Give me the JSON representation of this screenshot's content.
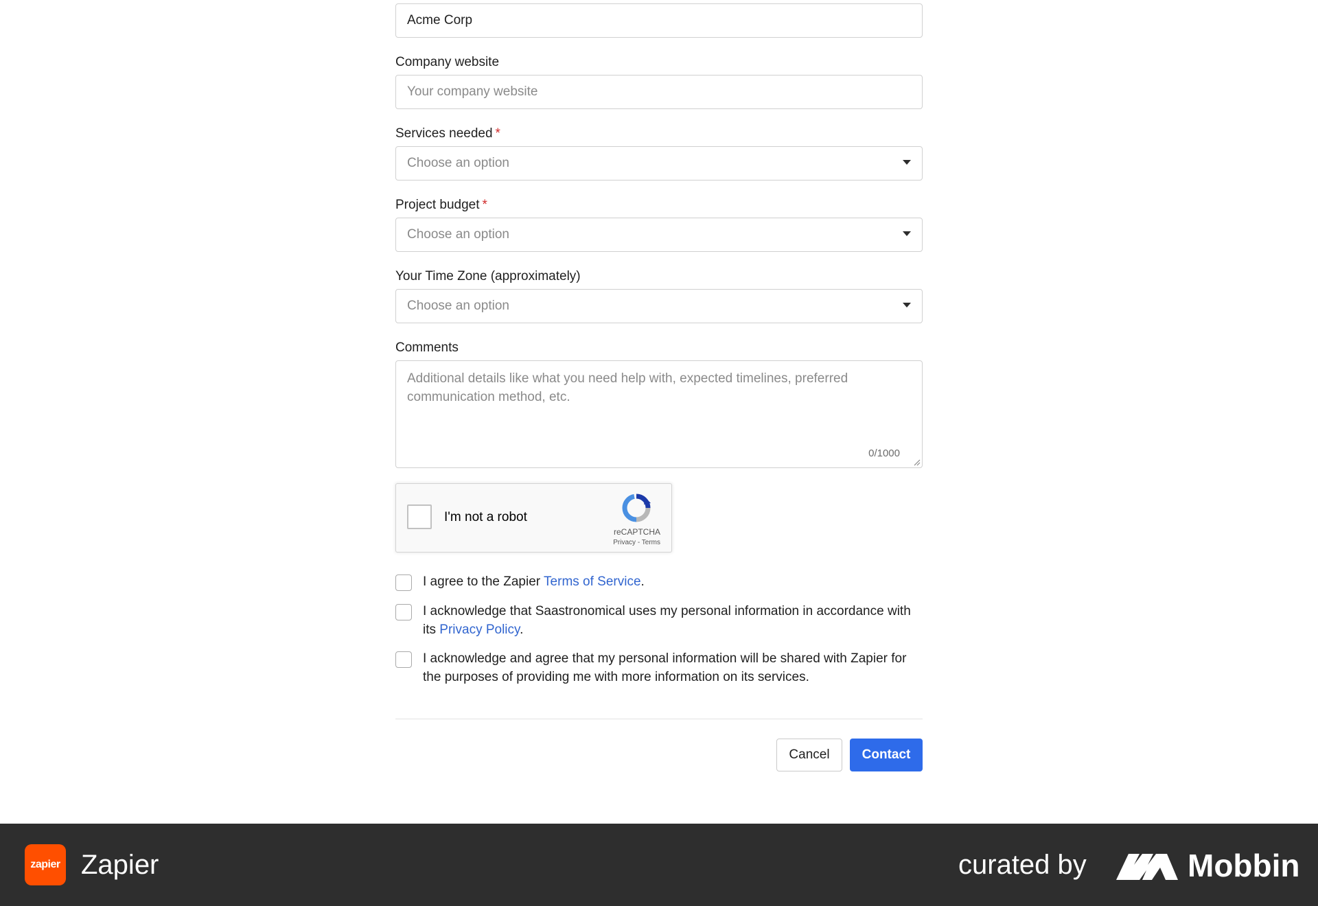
{
  "form": {
    "company_name": {
      "value": "Acme Corp"
    },
    "company_website": {
      "label": "Company website",
      "placeholder": "Your company website"
    },
    "services_needed": {
      "label": "Services needed",
      "required_mark": "*",
      "placeholder": "Choose an option"
    },
    "project_budget": {
      "label": "Project budget",
      "required_mark": "*",
      "placeholder": "Choose an option"
    },
    "time_zone": {
      "label": "Your Time Zone (approximately)",
      "placeholder": "Choose an option"
    },
    "comments": {
      "label": "Comments",
      "placeholder": "Additional details like what you need help with, expected timelines, preferred communication method, etc.",
      "counter": "0/1000"
    },
    "captcha": {
      "label": "I'm not a robot",
      "brand": "reCAPTCHA",
      "privacy": "Privacy",
      "separator": " - ",
      "terms": "Terms"
    },
    "agreements": [
      {
        "before": "I agree to the Zapier ",
        "link": "Terms of Service",
        "after": "."
      },
      {
        "before": "I acknowledge that Saastronomical uses my personal information in accordance with its ",
        "link": "Privacy Policy",
        "after": "."
      },
      {
        "before": "I acknowledge and agree that my personal information will be shared with Zapier for the purposes of providing me with more information on its services.",
        "link": "",
        "after": ""
      }
    ],
    "cancel_label": "Cancel",
    "contact_label": "Contact"
  },
  "footer": {
    "app_logo_text": "zapier",
    "app_name": "Zapier",
    "curated_by": "curated by",
    "brand": "Mobbin"
  },
  "colors": {
    "primary": "#2e6bea",
    "link": "#3165cf",
    "required": "#d12c2c",
    "footer_bg": "#2e2e2e",
    "zapier_orange": "#ff4f00"
  }
}
